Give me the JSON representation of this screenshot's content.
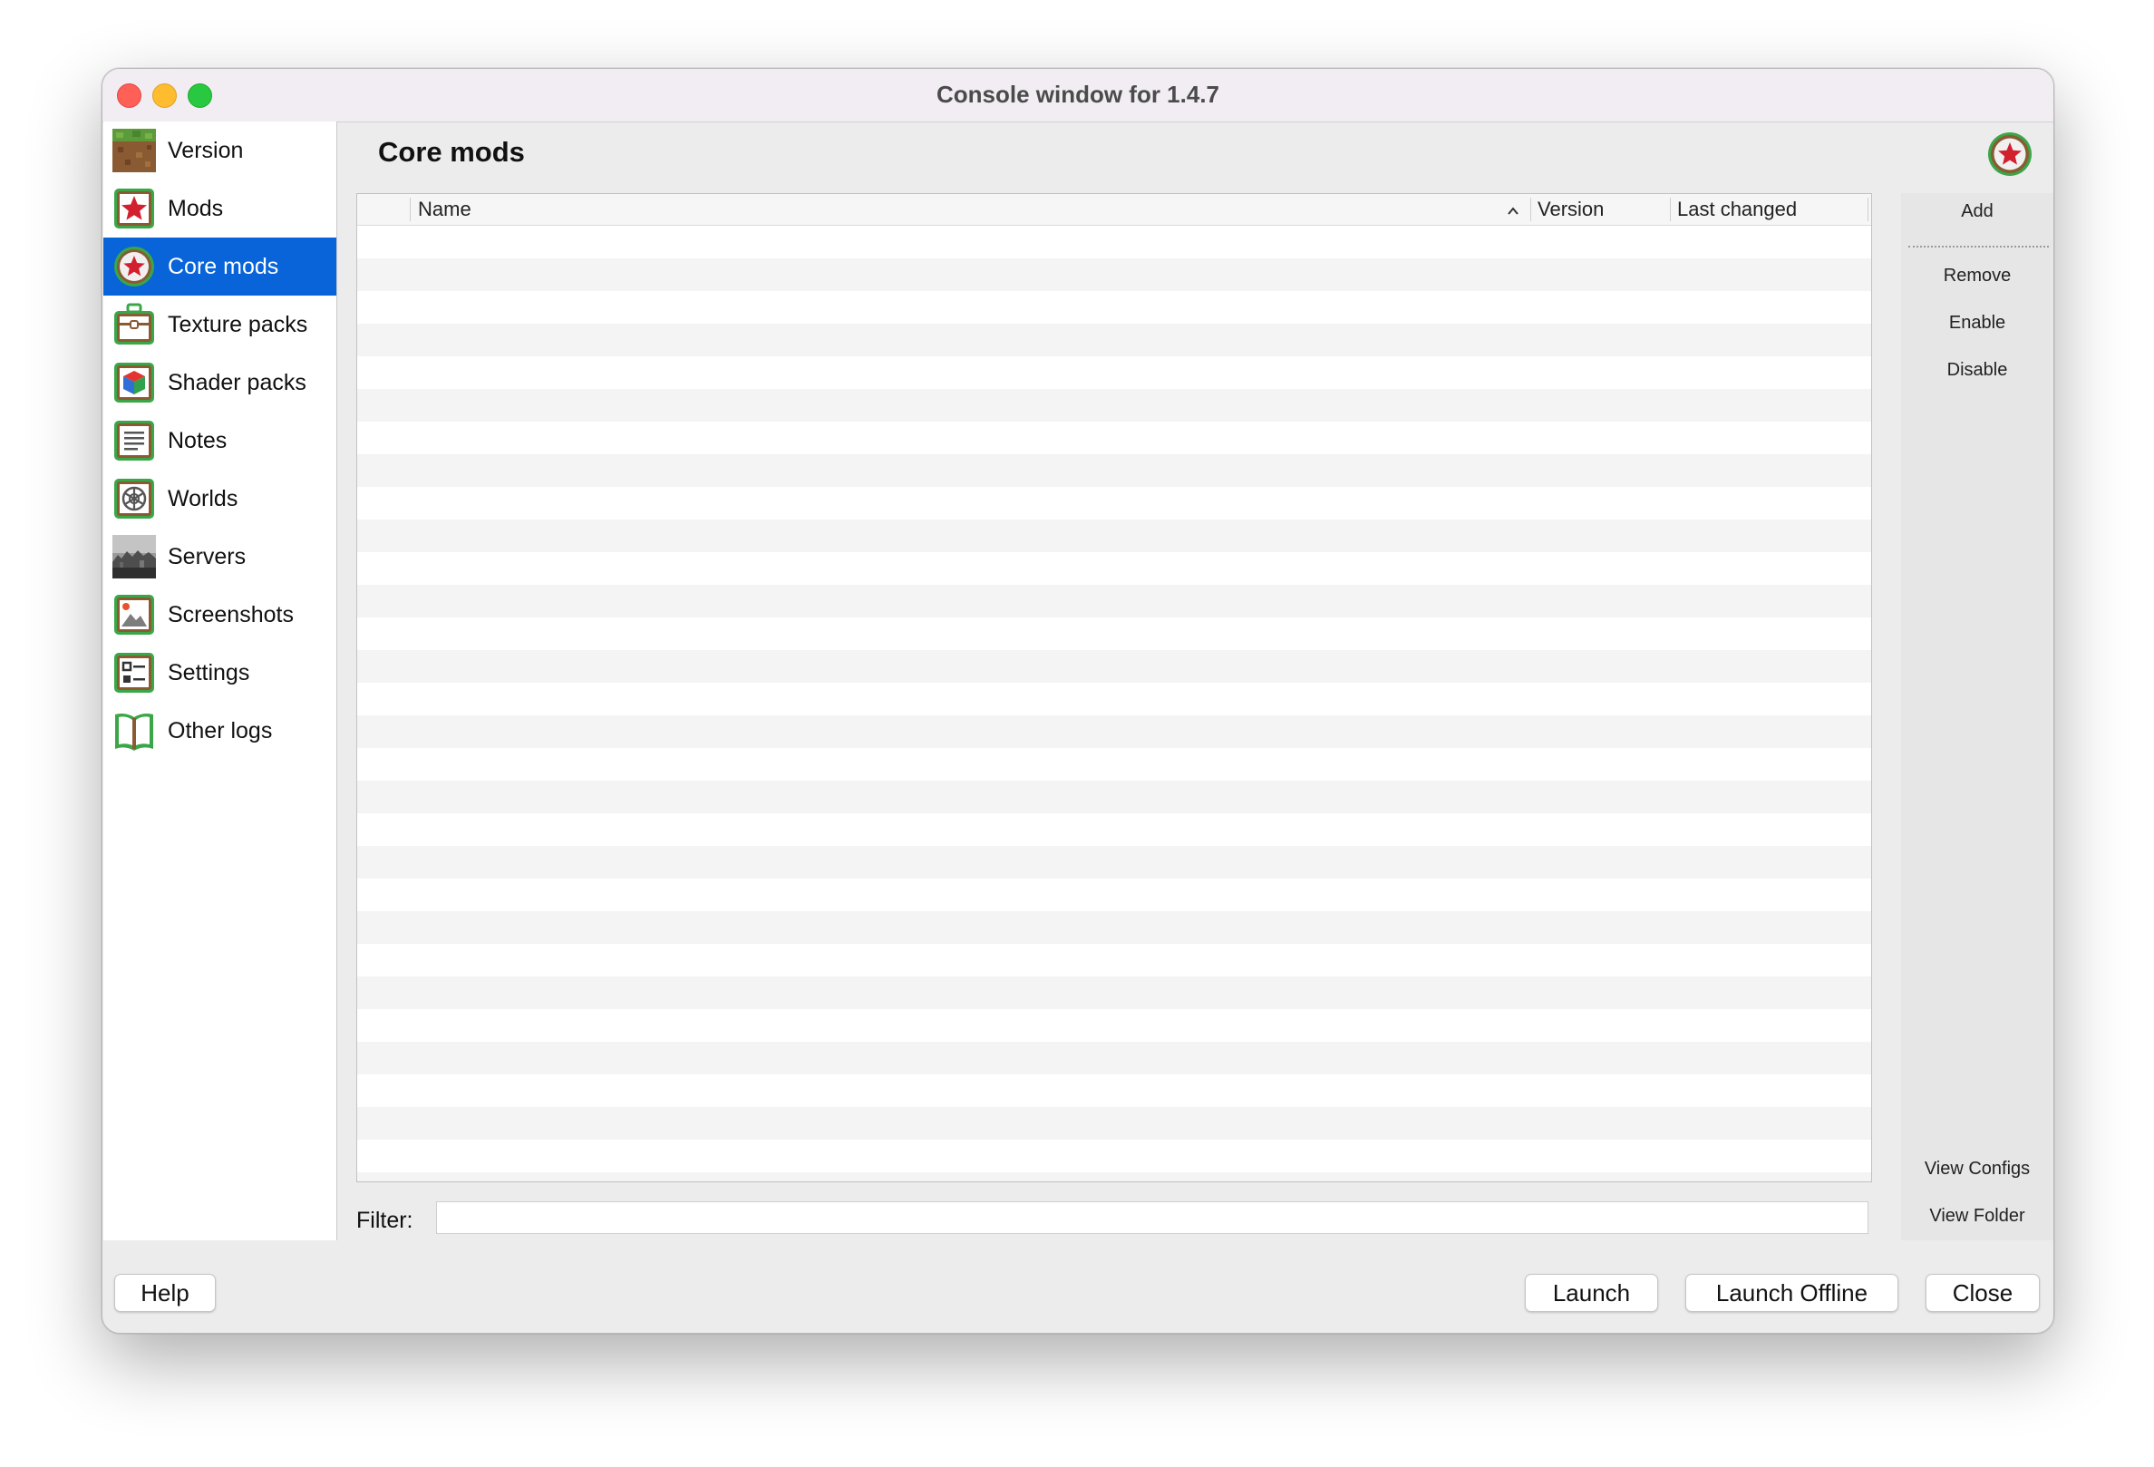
{
  "window": {
    "title": "Console window for 1.4.7"
  },
  "sidebar": {
    "items": [
      {
        "label": "Version",
        "icon": "grass-block-icon"
      },
      {
        "label": "Mods",
        "icon": "star-icon"
      },
      {
        "label": "Core mods",
        "icon": "star-badge-icon",
        "selected": true
      },
      {
        "label": "Texture packs",
        "icon": "briefcase-icon"
      },
      {
        "label": "Shader packs",
        "icon": "cube-icon"
      },
      {
        "label": "Notes",
        "icon": "notes-icon"
      },
      {
        "label": "Worlds",
        "icon": "globe-icon"
      },
      {
        "label": "Servers",
        "icon": "server-image-icon"
      },
      {
        "label": "Screenshots",
        "icon": "image-icon"
      },
      {
        "label": "Settings",
        "icon": "settings-list-icon"
      },
      {
        "label": "Other logs",
        "icon": "book-icon"
      }
    ]
  },
  "main": {
    "title": "Core mods",
    "table": {
      "columns": [
        "Name",
        "Version",
        "Last changed"
      ],
      "sorted_column": "Name",
      "sort_direction": "ascending",
      "rows": []
    },
    "filter": {
      "label": "Filter:",
      "value": ""
    }
  },
  "actions": {
    "add": "Add",
    "remove": "Remove",
    "enable": "Enable",
    "disable": "Disable",
    "view_configs": "View Configs",
    "view_folder": "View Folder"
  },
  "footer": {
    "help": "Help",
    "launch": "Launch",
    "launch_offline": "Launch Offline",
    "close": "Close"
  },
  "colors": {
    "selection": "#0864d8",
    "icon_frame_green": "#3aa648",
    "icon_frame_brown": "#8a5a32",
    "star_red": "#d3202f"
  }
}
